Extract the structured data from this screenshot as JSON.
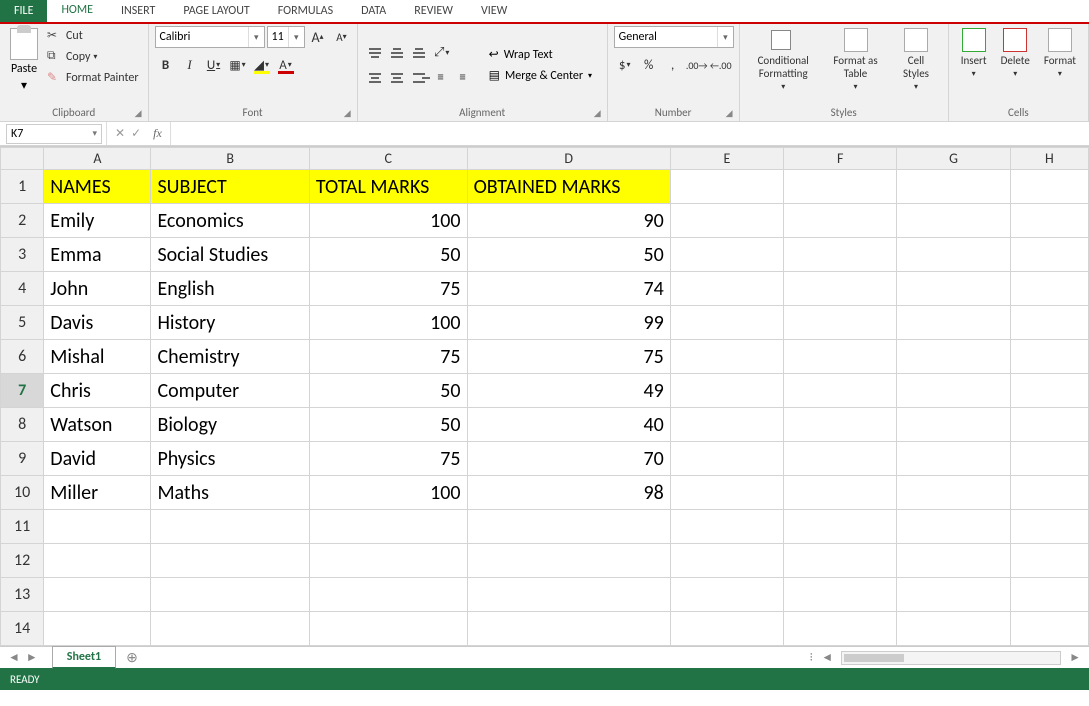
{
  "tabs": {
    "file": "FILE",
    "home": "HOME",
    "insert": "INSERT",
    "pageLayout": "PAGE LAYOUT",
    "formulas": "FORMULAS",
    "data": "DATA",
    "review": "REVIEW",
    "view": "VIEW"
  },
  "ribbon": {
    "clipboard": {
      "paste": "Paste",
      "cut": "Cut",
      "copy": "Copy",
      "formatPainter": "Format Painter",
      "label": "Clipboard"
    },
    "font": {
      "name": "Calibri",
      "size": "11",
      "label": "Font"
    },
    "alignment": {
      "wrap": "Wrap Text",
      "merge": "Merge & Center",
      "label": "Alignment"
    },
    "number": {
      "format": "General",
      "label": "Number",
      "percent": "%",
      "comma": ","
    },
    "styles": {
      "cond": "Conditional Formatting",
      "fmtTable": "Format as Table",
      "cellStyles": "Cell Styles",
      "label": "Styles"
    },
    "cells": {
      "insert": "Insert",
      "delete": "Delete",
      "format": "Format",
      "label": "Cells"
    }
  },
  "nameBox": "K7",
  "formula": "",
  "colHeaders": [
    "A",
    "B",
    "C",
    "D",
    "E",
    "F",
    "G",
    "H"
  ],
  "rowCount": 14,
  "selectedRow": 7,
  "headers": {
    "a": "NAMES",
    "b": "SUBJECT",
    "c": "TOTAL MARKS",
    "d": "OBTAINED MARKS"
  },
  "rows": [
    {
      "name": "Emily",
      "subject": "Economics",
      "total": "100",
      "obtained": "90"
    },
    {
      "name": "Emma",
      "subject": "Social Studies",
      "total": "50",
      "obtained": "50"
    },
    {
      "name": "John",
      "subject": "English",
      "total": "75",
      "obtained": "74"
    },
    {
      "name": "Davis",
      "subject": "History",
      "total": "100",
      "obtained": "99"
    },
    {
      "name": "Mishal",
      "subject": "Chemistry",
      "total": "75",
      "obtained": "75"
    },
    {
      "name": "Chris",
      "subject": "Computer",
      "total": "50",
      "obtained": "49"
    },
    {
      "name": "Watson",
      "subject": "Biology",
      "total": "50",
      "obtained": "40"
    },
    {
      "name": "David",
      "subject": "Physics",
      "total": "75",
      "obtained": "70"
    },
    {
      "name": "Miller",
      "subject": "Maths",
      "total": "100",
      "obtained": "98"
    }
  ],
  "sheetTab": "Sheet1",
  "status": "READY"
}
